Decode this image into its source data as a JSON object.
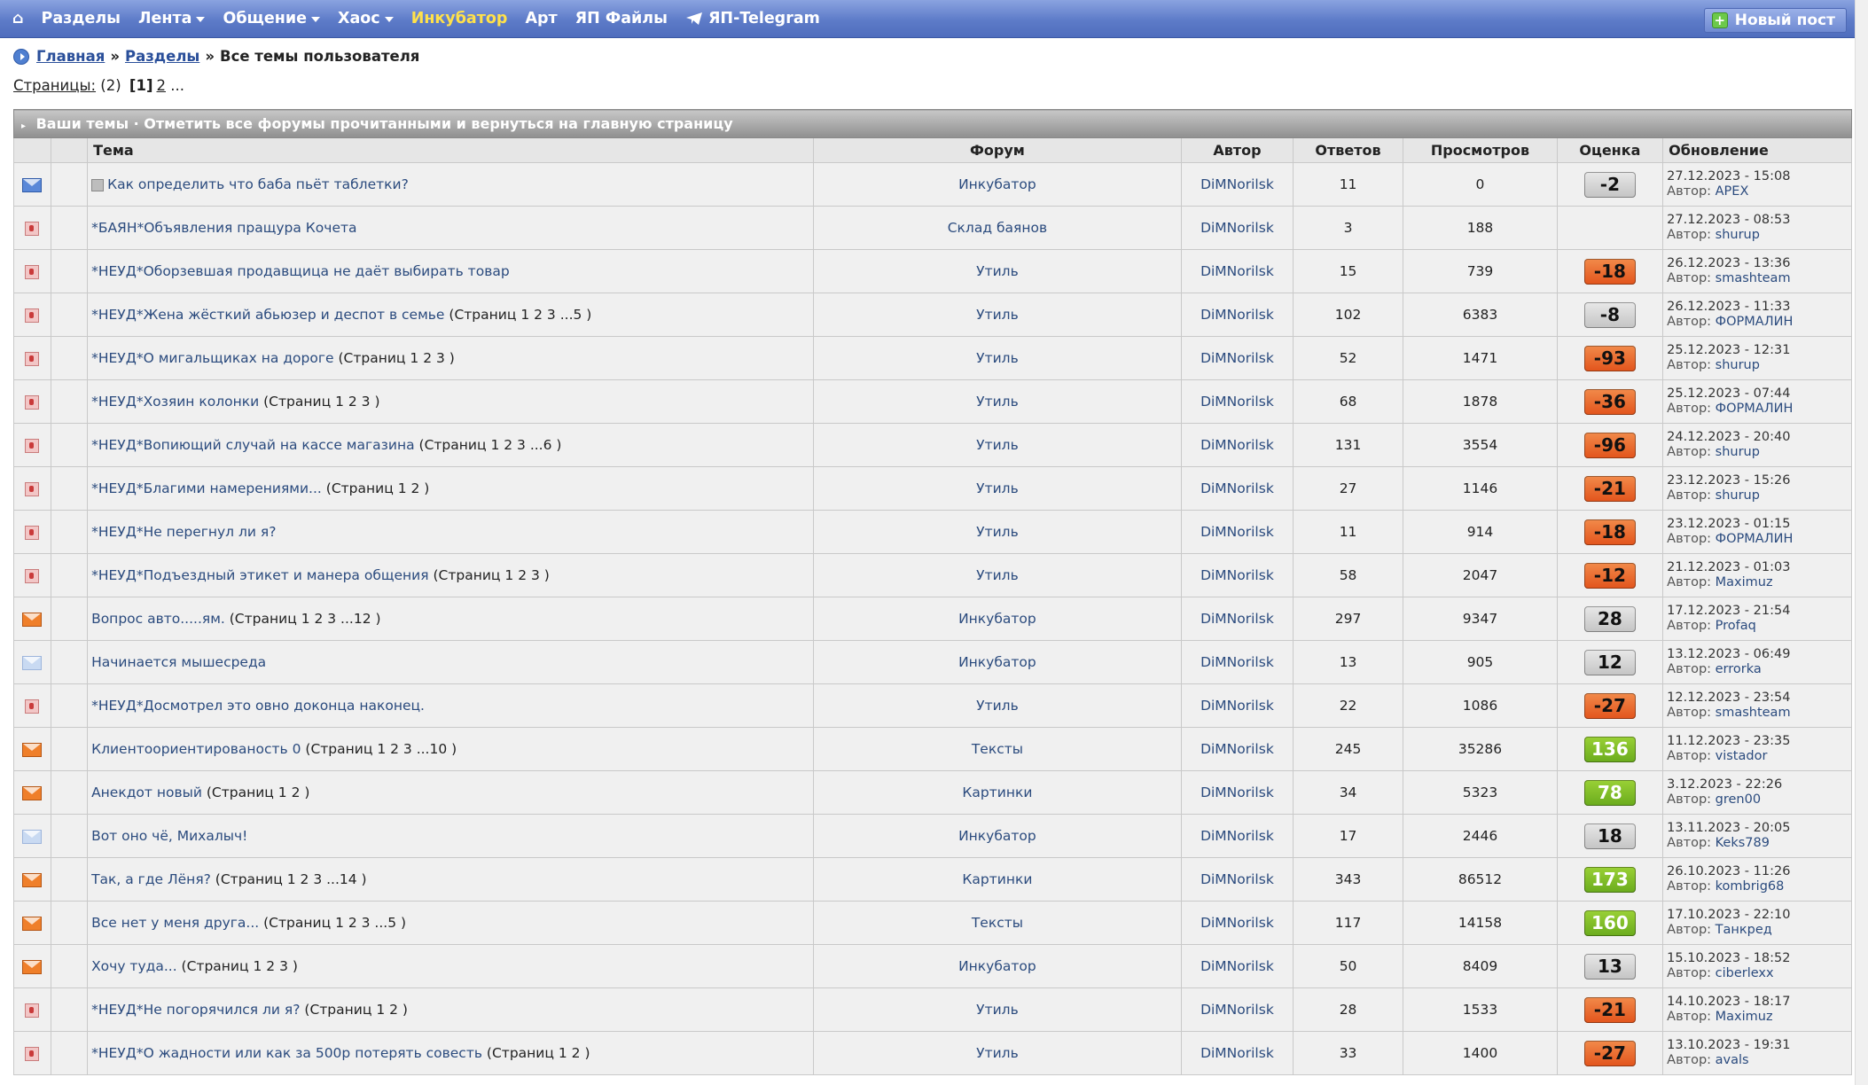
{
  "nav": {
    "items": [
      {
        "label": "Разделы",
        "caret": false,
        "active": false
      },
      {
        "label": "Лента",
        "caret": true,
        "active": false
      },
      {
        "label": "Общение",
        "caret": true,
        "active": false
      },
      {
        "label": "Хаос",
        "caret": true,
        "active": false
      },
      {
        "label": "Инкубатор",
        "caret": false,
        "active": true
      },
      {
        "label": "Арт",
        "caret": false,
        "active": false
      },
      {
        "label": "ЯП Файлы",
        "caret": false,
        "active": false
      },
      {
        "label": "ЯП-Telegram",
        "caret": false,
        "active": false
      }
    ],
    "new_post": "Новый пост",
    "home_icon": "home-icon"
  },
  "breadcrumb": {
    "home": "Главная",
    "sep": "»",
    "sections": "Разделы",
    "current": "Все темы пользователя"
  },
  "pages": {
    "label": "Страницы:",
    "total": "(2)",
    "current": "[1]",
    "next": "2",
    "more": "..."
  },
  "table": {
    "caption_title": "Ваши темы",
    "caption_dot": "·",
    "caption_link": "Отметить все форумы прочитанными и вернуться на главную страницу",
    "headers": [
      "Тема",
      "Форум",
      "Автор",
      "Ответов",
      "Просмотров",
      "Оценка",
      "Обновление"
    ],
    "pages_word": "Страниц",
    "by_label": "Автор:",
    "rows": [
      {
        "icon": "env-blue",
        "poll": true,
        "title": "Как определить что баба пьёт таблетки?",
        "pages": "",
        "forum": "Инкубатор",
        "author": "DiMNorilsk",
        "replies": "11",
        "views": "0",
        "rating": "-2",
        "rtype": "neu",
        "date": "27.12.2023 - 15:08",
        "last": "APEX"
      },
      {
        "icon": "closed",
        "poll": false,
        "title": "*БАЯН*Объявления пращура Кочета",
        "pages": "",
        "forum": "Склад баянов",
        "author": "DiMNorilsk",
        "replies": "3",
        "views": "188",
        "rating": "",
        "rtype": "",
        "date": "27.12.2023 - 08:53",
        "last": "shurup"
      },
      {
        "icon": "closed",
        "poll": false,
        "title": "*НЕУД*Оборзевшая продавщица не даёт выбирать товар",
        "pages": "",
        "forum": "Утиль",
        "author": "DiMNorilsk",
        "replies": "15",
        "views": "739",
        "rating": "-18",
        "rtype": "neg",
        "date": "26.12.2023 - 13:36",
        "last": "smashteam"
      },
      {
        "icon": "closed",
        "poll": false,
        "title": "*НЕУД*Жена жёсткий абьюзер и деспот в семье",
        "pages": "1 2 3 ...5",
        "forum": "Утиль",
        "author": "DiMNorilsk",
        "replies": "102",
        "views": "6383",
        "rating": "-8",
        "rtype": "neu",
        "date": "26.12.2023 - 11:33",
        "last": "ФОРМАЛИН"
      },
      {
        "icon": "closed",
        "poll": false,
        "title": "*НЕУД*О мигальщиках на дороге",
        "pages": "1 2 3",
        "forum": "Утиль",
        "author": "DiMNorilsk",
        "replies": "52",
        "views": "1471",
        "rating": "-93",
        "rtype": "neg",
        "date": "25.12.2023 - 12:31",
        "last": "shurup"
      },
      {
        "icon": "closed",
        "poll": false,
        "title": "*НЕУД*Хозяин колонки",
        "pages": "1 2 3",
        "forum": "Утиль",
        "author": "DiMNorilsk",
        "replies": "68",
        "views": "1878",
        "rating": "-36",
        "rtype": "neg",
        "date": "25.12.2023 - 07:44",
        "last": "ФОРМАЛИН"
      },
      {
        "icon": "closed",
        "poll": false,
        "title": "*НЕУД*Вопиющий случай на кассе магазина",
        "pages": "1 2 3 ...6",
        "forum": "Утиль",
        "author": "DiMNorilsk",
        "replies": "131",
        "views": "3554",
        "rating": "-96",
        "rtype": "neg",
        "date": "24.12.2023 - 20:40",
        "last": "shurup"
      },
      {
        "icon": "closed",
        "poll": false,
        "title": "*НЕУД*Благими намерениями...",
        "pages": "1 2",
        "forum": "Утиль",
        "author": "DiMNorilsk",
        "replies": "27",
        "views": "1146",
        "rating": "-21",
        "rtype": "neg",
        "date": "23.12.2023 - 15:26",
        "last": "shurup"
      },
      {
        "icon": "closed",
        "poll": false,
        "title": "*НЕУД*Не перегнул ли я?",
        "pages": "",
        "forum": "Утиль",
        "author": "DiMNorilsk",
        "replies": "11",
        "views": "914",
        "rating": "-18",
        "rtype": "neg",
        "date": "23.12.2023 - 01:15",
        "last": "ФОРМАЛИН"
      },
      {
        "icon": "closed",
        "poll": false,
        "title": "*НЕУД*Подъездный этикет и манера общения",
        "pages": "1 2 3",
        "forum": "Утиль",
        "author": "DiMNorilsk",
        "replies": "58",
        "views": "2047",
        "rating": "-12",
        "rtype": "neg",
        "date": "21.12.2023 - 01:03",
        "last": "Maximuz"
      },
      {
        "icon": "env-orange",
        "poll": false,
        "title": "Вопрос авто.....ям.",
        "pages": "1 2 3 ...12",
        "forum": "Инкубатор",
        "author": "DiMNorilsk",
        "replies": "297",
        "views": "9347",
        "rating": "28",
        "rtype": "neu",
        "date": "17.12.2023 - 21:54",
        "last": "Profaq"
      },
      {
        "icon": "env-light",
        "poll": false,
        "title": "Начинается мышесреда",
        "pages": "",
        "forum": "Инкубатор",
        "author": "DiMNorilsk",
        "replies": "13",
        "views": "905",
        "rating": "12",
        "rtype": "neu",
        "date": "13.12.2023 - 06:49",
        "last": "errorka"
      },
      {
        "icon": "closed",
        "poll": false,
        "title": "*НЕУД*Досмотрел это овно доконца наконец.",
        "pages": "",
        "forum": "Утиль",
        "author": "DiMNorilsk",
        "replies": "22",
        "views": "1086",
        "rating": "-27",
        "rtype": "neg",
        "date": "12.12.2023 - 23:54",
        "last": "smashteam"
      },
      {
        "icon": "env-orange",
        "poll": false,
        "title": "Клиентоориентированость 0",
        "pages": "1 2 3 ...10",
        "forum": "Тексты",
        "author": "DiMNorilsk",
        "replies": "245",
        "views": "35286",
        "rating": "136",
        "rtype": "pos",
        "date": "11.12.2023 - 23:35",
        "last": "vistador"
      },
      {
        "icon": "env-orange",
        "poll": false,
        "title": "Анекдот новый",
        "pages": "1 2",
        "forum": "Картинки",
        "author": "DiMNorilsk",
        "replies": "34",
        "views": "5323",
        "rating": "78",
        "rtype": "pos",
        "date": "3.12.2023 - 22:26",
        "last": "gren00"
      },
      {
        "icon": "env-light",
        "poll": false,
        "title": "Вот оно чё, Михалыч!",
        "pages": "",
        "forum": "Инкубатор",
        "author": "DiMNorilsk",
        "replies": "17",
        "views": "2446",
        "rating": "18",
        "rtype": "neu",
        "date": "13.11.2023 - 20:05",
        "last": "Keks789"
      },
      {
        "icon": "env-orange",
        "poll": false,
        "title": "Так, а где Лёня?",
        "pages": "1 2 3 ...14",
        "forum": "Картинки",
        "author": "DiMNorilsk",
        "replies": "343",
        "views": "86512",
        "rating": "173",
        "rtype": "pos",
        "date": "26.10.2023 - 11:26",
        "last": "kombrig68"
      },
      {
        "icon": "env-orange",
        "poll": false,
        "title": "Все нет у меня друга...",
        "pages": "1 2 3 ...5",
        "forum": "Тексты",
        "author": "DiMNorilsk",
        "replies": "117",
        "views": "14158",
        "rating": "160",
        "rtype": "pos",
        "date": "17.10.2023 - 22:10",
        "last": "Танкред"
      },
      {
        "icon": "env-orange",
        "poll": false,
        "title": "Хочу туда...",
        "pages": "1 2 3",
        "forum": "Инкубатор",
        "author": "DiMNorilsk",
        "replies": "50",
        "views": "8409",
        "rating": "13",
        "rtype": "neu",
        "date": "15.10.2023 - 18:52",
        "last": "ciberlexx"
      },
      {
        "icon": "closed",
        "poll": false,
        "title": "*НЕУД*Не погорячился ли я?",
        "pages": "1 2",
        "forum": "Утиль",
        "author": "DiMNorilsk",
        "replies": "28",
        "views": "1533",
        "rating": "-21",
        "rtype": "neg",
        "date": "14.10.2023 - 18:17",
        "last": "Maximuz"
      },
      {
        "icon": "closed",
        "poll": false,
        "title": "*НЕУД*О жадности или как за 500р потерять совесть",
        "pages": "1 2",
        "forum": "Утиль",
        "author": "DiMNorilsk",
        "replies": "33",
        "views": "1400",
        "rating": "-27",
        "rtype": "neg",
        "date": "13.10.2023 - 19:31",
        "last": "avals"
      }
    ]
  }
}
